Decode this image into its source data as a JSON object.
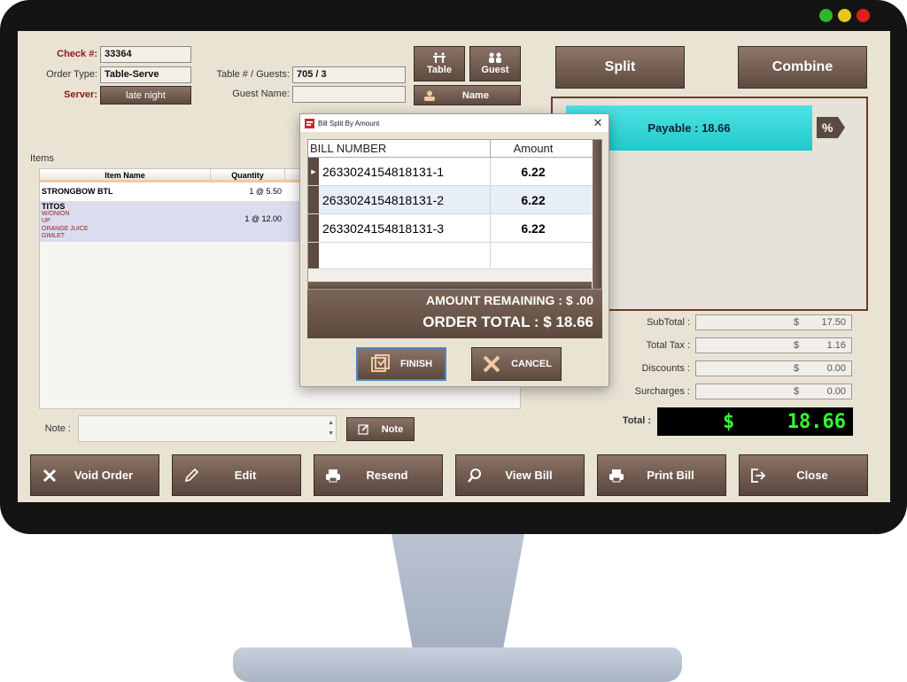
{
  "header": {
    "check_label": "Check #:",
    "check_value": "33364",
    "order_type_label": "Order Type:",
    "order_type_value": "Table-Serve",
    "server_label": "Server:",
    "server_value": "late night",
    "table_guests_label": "Table # / Guests:",
    "table_guests_value": "705 / 3",
    "guest_name_label": "Guest Name:",
    "guest_name_value": ""
  },
  "top_buttons": {
    "table": "Table",
    "guest": "Guest",
    "name": "Name",
    "split": "Split",
    "combine": "Combine"
  },
  "payable": "Payable : 18.66",
  "items": {
    "section_label": "Items",
    "columns": [
      "Item Name",
      "Quantity"
    ],
    "rows": [
      {
        "name": "STRONGBOW BTL",
        "qty": "1 @ 5.50",
        "mods": []
      },
      {
        "name": "TITOS",
        "qty": "1 @ 12.00",
        "mods": [
          "W/ONION",
          "UP",
          "ORANGE JUICE",
          "GIMLET"
        ]
      }
    ]
  },
  "note": {
    "label": "Note :",
    "button": "Note"
  },
  "totals": {
    "subtotal_label": "SubTotal :",
    "subtotal_currency": "$",
    "subtotal": "17.50",
    "tax_label": "Total Tax :",
    "tax_currency": "$",
    "tax": "1.16",
    "discounts_label": "Discounts :",
    "discounts_currency": "$",
    "discounts": "0.00",
    "surcharges_label": "Surcharges :",
    "surcharges_currency": "$",
    "surcharges": "0.00",
    "total_label": "Total :",
    "total_currency": "$",
    "total": "18.66"
  },
  "bottom_buttons": {
    "void": "Void Order",
    "edit": "Edit",
    "resend": "Resend",
    "view_bill": "View Bill",
    "print_bill": "Print Bill",
    "close": "Close"
  },
  "dialog": {
    "title": "Bill Split By Amount",
    "col_bill": "BILL NUMBER",
    "col_amount": "Amount",
    "rows": [
      {
        "bill": "2633024154818131-1",
        "amount": "6.22"
      },
      {
        "bill": "2633024154818131-2",
        "amount": "6.22"
      },
      {
        "bill": "2633024154818131-3",
        "amount": "6.22"
      }
    ],
    "amount_remaining": "AMOUNT REMAINING : $ .00",
    "order_total": "ORDER TOTAL : $ 18.66",
    "finish": "FINISH",
    "cancel": "CANCEL"
  },
  "colors": {
    "accent_payable": "#28d6d6",
    "total_text": "#33ff33",
    "button_brown": "#6b564a",
    "dot_green": "#2fb52f",
    "dot_yellow": "#e8c51c",
    "dot_red": "#e02020"
  }
}
